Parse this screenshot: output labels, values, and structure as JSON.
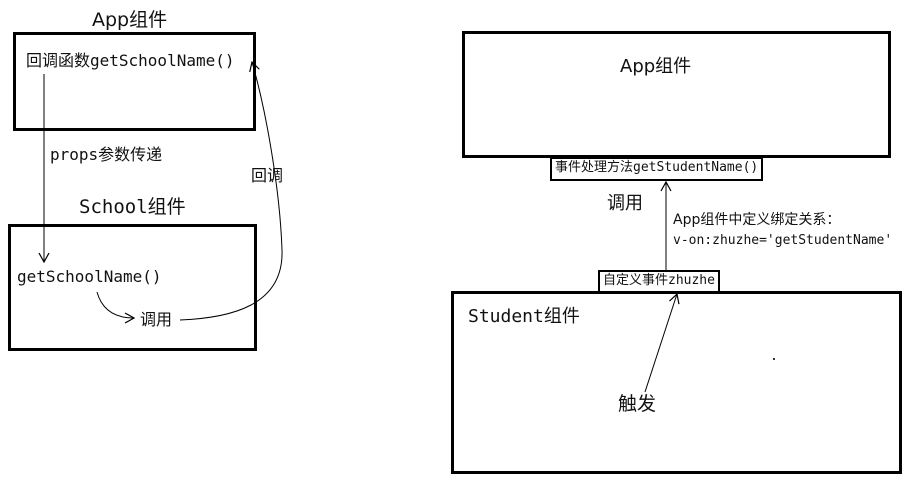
{
  "left": {
    "app_title": "App组件",
    "callback_function": "回调函数getSchoolName()",
    "props_label": "props参数传递",
    "callback_label": "回调",
    "school_title": "School组件",
    "school_function": "getSchoolName()",
    "call_label": "调用"
  },
  "right": {
    "app_title": "App组件",
    "handler_tag": "事件处理方法getStudentName()",
    "call_label": "调用",
    "binding_line1": "App组件中定义绑定关系：",
    "binding_line2": "v-on:zhuzhe='getStudentName'",
    "custom_event_tag": "自定义事件zhuzhe",
    "student_title": "Student组件",
    "trigger_label": "触发"
  }
}
